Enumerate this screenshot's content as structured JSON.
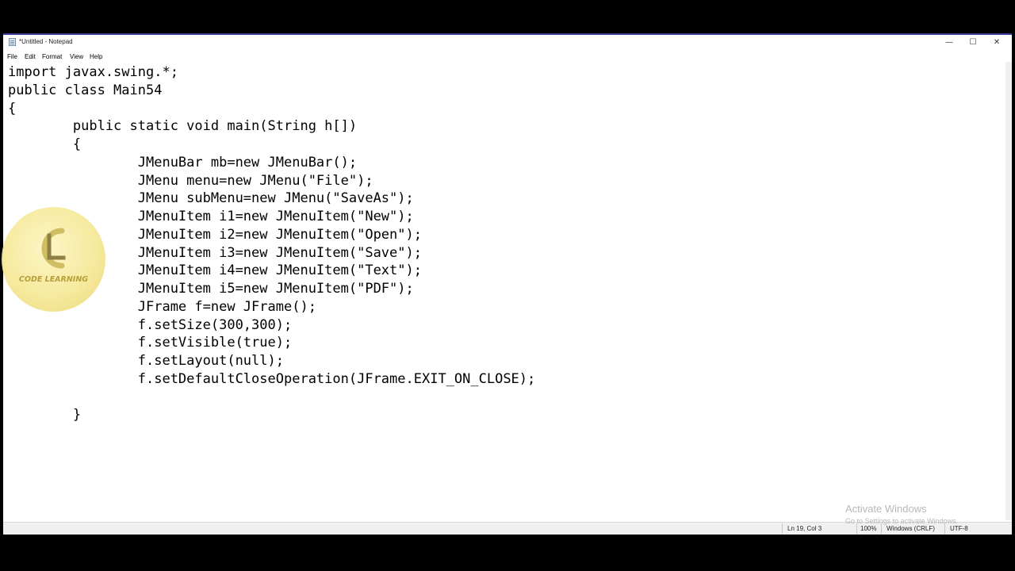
{
  "window": {
    "title": "*Untitled - Notepad",
    "controls": {
      "minimize_glyph": "—",
      "maximize_glyph": "☐",
      "close_glyph": "✕"
    }
  },
  "menu": {
    "items": [
      "File",
      "Edit",
      "Format",
      "View",
      "Help"
    ]
  },
  "editor": {
    "lines": [
      "import javax.swing.*;",
      "public class Main54",
      "{",
      "\tpublic static void main(String h[])",
      "\t{",
      "\t\tJMenuBar mb=new JMenuBar();",
      "\t\tJMenu menu=new JMenu(\"File\");",
      "\t\tJMenu subMenu=new JMenu(\"SaveAs\");",
      "\t\tJMenuItem i1=new JMenuItem(\"New\");",
      "\t\tJMenuItem i2=new JMenuItem(\"Open\");",
      "\t\tJMenuItem i3=new JMenuItem(\"Save\");",
      "\t\tJMenuItem i4=new JMenuItem(\"Text\");",
      "\t\tJMenuItem i5=new JMenuItem(\"PDF\");",
      "\t\tJFrame f=new JFrame();",
      "\t\tf.setSize(300,300);",
      "\t\tf.setVisible(true);",
      "\t\tf.setLayout(null);",
      "\t\tf.setDefaultCloseOperation(JFrame.EXIT_ON_CLOSE);",
      "",
      "\t}"
    ]
  },
  "status": {
    "position": "Ln 19, Col 3",
    "zoom": "100%",
    "line_ending": "Windows (CRLF)",
    "encoding": "UTF-8"
  },
  "watermark": {
    "title": "Activate Windows",
    "subtitle": "Go to Settings to activate Windows."
  },
  "logo": {
    "text": "CODE LEARNING"
  },
  "colors": {
    "window_border": "#3b3d99",
    "background": "#000000",
    "logo_gold": "#f6e99a"
  }
}
